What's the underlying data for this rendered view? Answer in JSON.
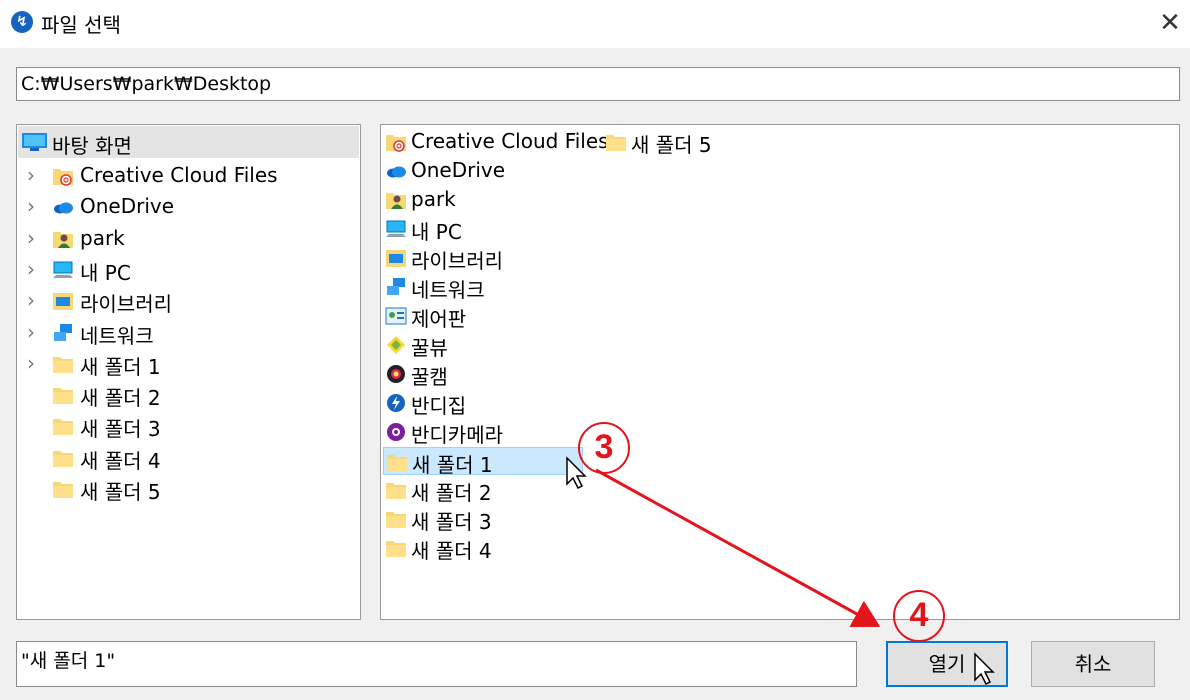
{
  "window": {
    "title": "파일 선택",
    "app_icon": "bandizip-icon",
    "close_glyph": "✕"
  },
  "path": {
    "value": "C:₩Users₩park₩Desktop"
  },
  "tree": {
    "root": {
      "label": "바탕 화면",
      "icon": "desktop-icon"
    },
    "items": [
      {
        "label": "Creative Cloud Files",
        "icon": "creative-cloud-folder-icon",
        "expandable": true
      },
      {
        "label": "OneDrive",
        "icon": "onedrive-icon",
        "expandable": true
      },
      {
        "label": "park",
        "icon": "user-folder-icon",
        "expandable": true
      },
      {
        "label": "내 PC",
        "icon": "pc-icon",
        "expandable": true
      },
      {
        "label": "라이브러리",
        "icon": "library-icon",
        "expandable": true
      },
      {
        "label": "네트워크",
        "icon": "network-icon",
        "expandable": true
      },
      {
        "label": "새 폴더 1",
        "icon": "folder-icon",
        "expandable": true
      },
      {
        "label": "새 폴더 2",
        "icon": "folder-icon",
        "expandable": false
      },
      {
        "label": "새 폴더 3",
        "icon": "folder-icon",
        "expandable": false
      },
      {
        "label": "새 폴더 4",
        "icon": "folder-icon",
        "expandable": false
      },
      {
        "label": "새 폴더 5",
        "icon": "folder-icon",
        "expandable": false
      }
    ]
  },
  "list": {
    "items": [
      {
        "label": "Creative Cloud Files",
        "icon": "creative-cloud-folder-icon"
      },
      {
        "label": "새 폴더 5",
        "icon": "folder-icon"
      },
      {
        "label": "OneDrive",
        "icon": "onedrive-icon"
      },
      {
        "label": "park",
        "icon": "user-folder-icon"
      },
      {
        "label": "내 PC",
        "icon": "pc-icon"
      },
      {
        "label": "라이브러리",
        "icon": "library-icon"
      },
      {
        "label": "네트워크",
        "icon": "network-icon"
      },
      {
        "label": "제어판",
        "icon": "control-panel-icon"
      },
      {
        "label": "꿀뷰",
        "icon": "honeyview-icon"
      },
      {
        "label": "꿀캠",
        "icon": "honeycam-icon"
      },
      {
        "label": "반디집",
        "icon": "bandizip-icon"
      },
      {
        "label": "반디카메라",
        "icon": "bandicam-icon"
      },
      {
        "label": "새 폴더 1",
        "icon": "folder-icon",
        "selected": true
      },
      {
        "label": "새 폴더 2",
        "icon": "folder-icon"
      },
      {
        "label": "새 폴더 3",
        "icon": "folder-icon"
      },
      {
        "label": "새 폴더 4",
        "icon": "folder-icon"
      }
    ]
  },
  "filename": {
    "value": "\"새 폴더 1\""
  },
  "buttons": {
    "open": "열기",
    "cancel": "취소"
  },
  "annotations": {
    "step3": "3",
    "step4": "4",
    "color": "#e3141b"
  },
  "colors": {
    "selection": "#cce8ff",
    "accent": "#0078d7"
  }
}
